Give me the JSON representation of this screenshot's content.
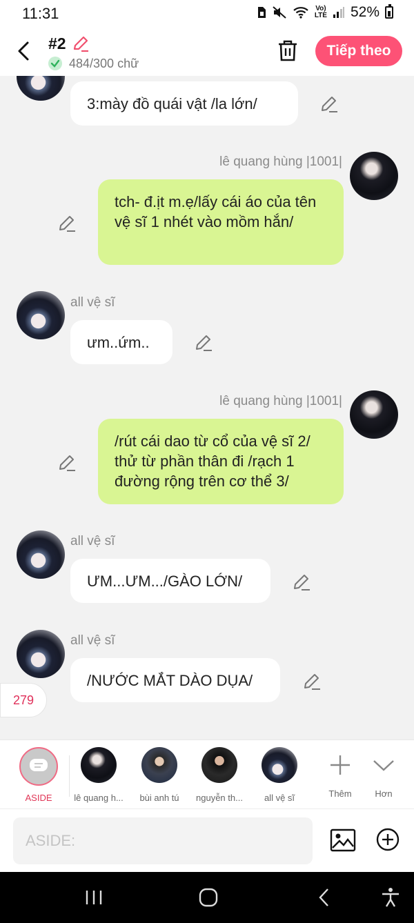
{
  "status_bar": {
    "time": "11:31",
    "volte": "Vo)\nLTE",
    "battery": "52%"
  },
  "header": {
    "title": "#2",
    "word_count": "484/300 chữ",
    "next_label": "Tiếp theo"
  },
  "messages": [
    {
      "side": "left",
      "sender": "",
      "text": "3:mày đồ quái vật /la lớn/"
    },
    {
      "side": "right",
      "sender": "lê quang hùng |1001|",
      "text": "tch- đ.ịt m.ẹ/lấy cái áo của tên vệ sĩ 1 nhét vào mồm hắn/"
    },
    {
      "side": "left",
      "sender": "all vệ sĩ",
      "text": "ưm..ứm.."
    },
    {
      "side": "right",
      "sender": "lê quang hùng |1001|",
      "text": "/rút cái dao từ cổ của vệ sĩ 2/ thử từ phần thân đi /rạch 1 đường rộng trên cơ thể 3/"
    },
    {
      "side": "left",
      "sender": "all vệ sĩ",
      "text": "ƯM...ƯM.../GÀO LỚN/"
    },
    {
      "side": "left",
      "sender": "all vệ sĩ",
      "text": "/NƯỚC MẮT DÀO DỤA/"
    }
  ],
  "counter_badge": "279",
  "characters": {
    "aside_label": "ASIDE",
    "items": [
      {
        "name": "lê quang h..."
      },
      {
        "name": "bùi anh tú"
      },
      {
        "name": "nguyễn th..."
      },
      {
        "name": "all vệ sĩ"
      }
    ],
    "more_label": "Thêm",
    "expand_label": "Hơn"
  },
  "input": {
    "placeholder": "ASIDE:"
  },
  "colors": {
    "accent": "#fd5276",
    "bubble_right": "#d9f593",
    "bubble_left": "#ffffff",
    "background": "#f2f2f2"
  }
}
